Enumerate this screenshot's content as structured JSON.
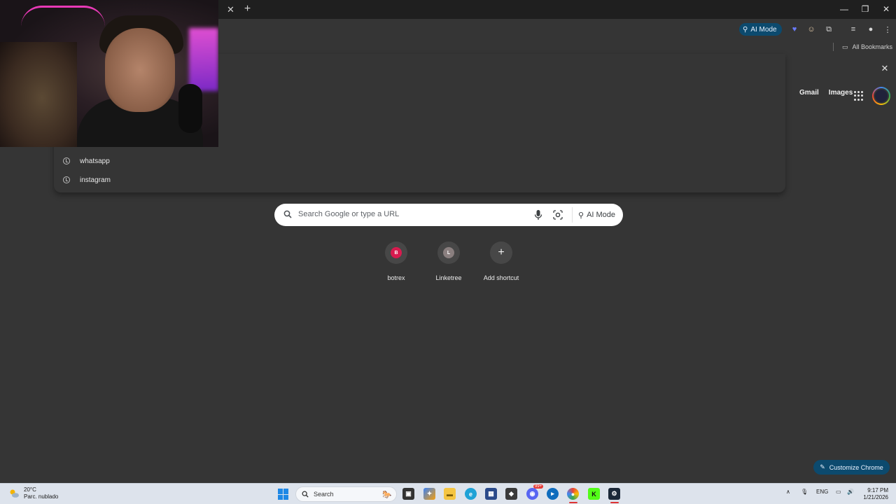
{
  "browser": {
    "ai_mode_chip": "AI Mode",
    "bookmarks_label": "All Bookmarks",
    "window_controls": [
      "minimize",
      "restore",
      "close"
    ]
  },
  "omnibox_dropdown": {
    "suggestions": [
      {
        "icon": "history-icon",
        "text": "whatsapp"
      },
      {
        "icon": "history-icon",
        "text": "instagram"
      }
    ]
  },
  "google_header": {
    "gmail": "Gmail",
    "images": "Images"
  },
  "search": {
    "placeholder": "Search Google or type a URL",
    "ai_mode": "AI Mode"
  },
  "shortcuts": [
    {
      "label": "botrex",
      "badge": "B",
      "color": "#d81b4f"
    },
    {
      "label": "Linketree",
      "badge": "L",
      "color": "#8a7f7f"
    },
    {
      "label": "Add shortcut",
      "badge": "+",
      "color": ""
    }
  ],
  "customize": {
    "label": "Customize Chrome"
  },
  "taskbar": {
    "weather_temp": "20°C",
    "weather_desc": "Parc. nublado",
    "search_placeholder": "Search",
    "language": "ENG",
    "time": "9:17 PM",
    "date": "1/21/2026",
    "discord_badge": "99+"
  },
  "colors": {
    "background": "#353535",
    "accent_chip": "#0c4a6e",
    "taskbar": "#dde3ec"
  }
}
